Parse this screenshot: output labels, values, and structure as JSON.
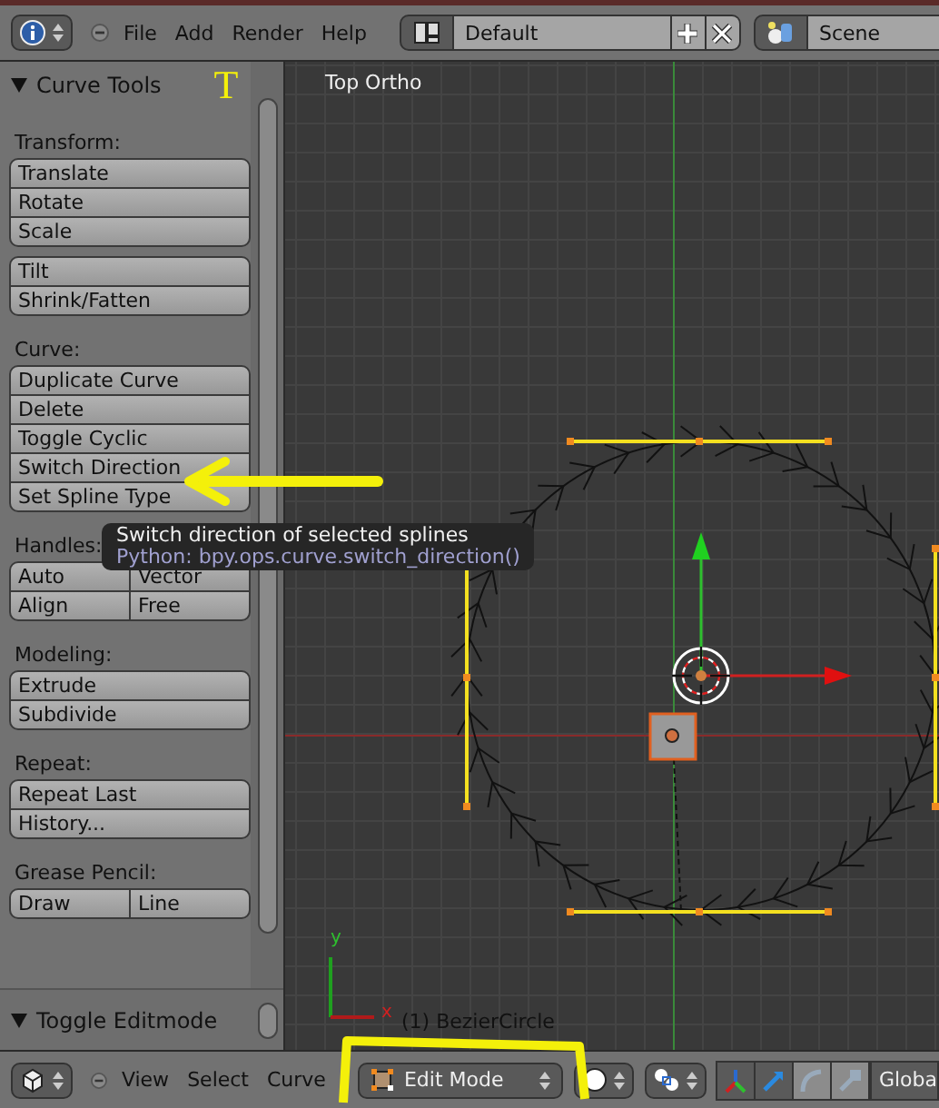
{
  "top_bar": {
    "menus": [
      "File",
      "Add",
      "Render",
      "Help"
    ],
    "layout": "Default",
    "scene": "Scene"
  },
  "tool_shelf": {
    "title": "Curve Tools",
    "hotkey": "T",
    "sections": [
      {
        "label": "Transform:",
        "groups": [
          [
            [
              "Translate"
            ],
            [
              "Rotate"
            ],
            [
              "Scale"
            ]
          ],
          [
            [
              "Tilt"
            ],
            [
              "Shrink/Fatten"
            ]
          ]
        ]
      },
      {
        "label": "Curve:",
        "groups": [
          [
            [
              "Duplicate Curve"
            ],
            [
              "Delete"
            ],
            [
              "Toggle Cyclic"
            ],
            [
              "Switch Direction"
            ],
            [
              "Set Spline Type"
            ]
          ]
        ]
      },
      {
        "label": "Handles:",
        "groups": [
          [
            [
              "Auto",
              "Vector"
            ],
            [
              "Align",
              "Free"
            ]
          ]
        ]
      },
      {
        "label": "Modeling:",
        "groups": [
          [
            [
              "Extrude"
            ],
            [
              "Subdivide"
            ]
          ]
        ]
      },
      {
        "label": "Repeat:",
        "groups": [
          [
            [
              "Repeat Last"
            ],
            [
              "History..."
            ]
          ]
        ]
      },
      {
        "label": "Grease Pencil:",
        "groups": [
          [
            [
              "Draw",
              "Line"
            ]
          ]
        ]
      }
    ],
    "bottom_panel": "Toggle Editmode"
  },
  "tooltip": {
    "title": "Switch direction of selected splines",
    "python": "Python: bpy.ops.curve.switch_direction()"
  },
  "viewport": {
    "view_label": "Top Ortho",
    "object_label": "(1) BezierCircle",
    "axis_x": "x",
    "axis_y": "y"
  },
  "bottom_bar": {
    "menus": [
      "View",
      "Select",
      "Curve"
    ],
    "mode": "Edit Mode",
    "orientation": "Globa"
  }
}
